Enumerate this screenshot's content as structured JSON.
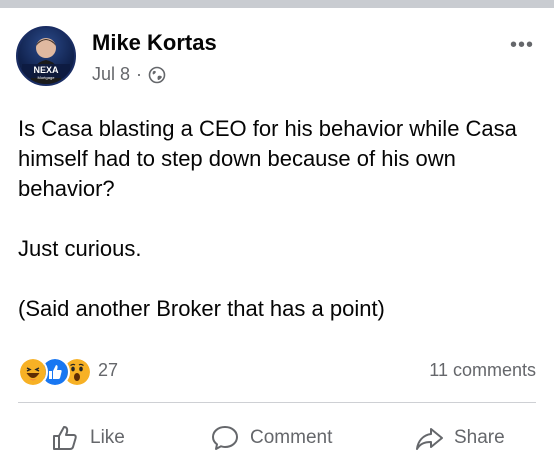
{
  "post": {
    "author": "Mike Kortas",
    "date": "Jul 8",
    "separator": "·",
    "avatar_brand": "NEXA",
    "avatar_subtext": "Mortgage",
    "more_menu": "•••",
    "text_lines": [
      "Is Casa blasting a CEO for his behavior while Casa himself had to step down because of his own behavior?",
      "Just curious.",
      "(Said another Broker that has a point)"
    ]
  },
  "stats": {
    "reaction_count": "27",
    "comments_count": "11 comments",
    "reaction_icons": [
      "haha-icon",
      "like-icon",
      "wow-icon"
    ]
  },
  "actions": {
    "like": "Like",
    "comment": "Comment",
    "share": "Share"
  },
  "colors": {
    "muted_text": "#65676b",
    "like_blue": "#1877f2",
    "reaction_yellow": "#f7b125",
    "divider": "#ced0d4"
  }
}
